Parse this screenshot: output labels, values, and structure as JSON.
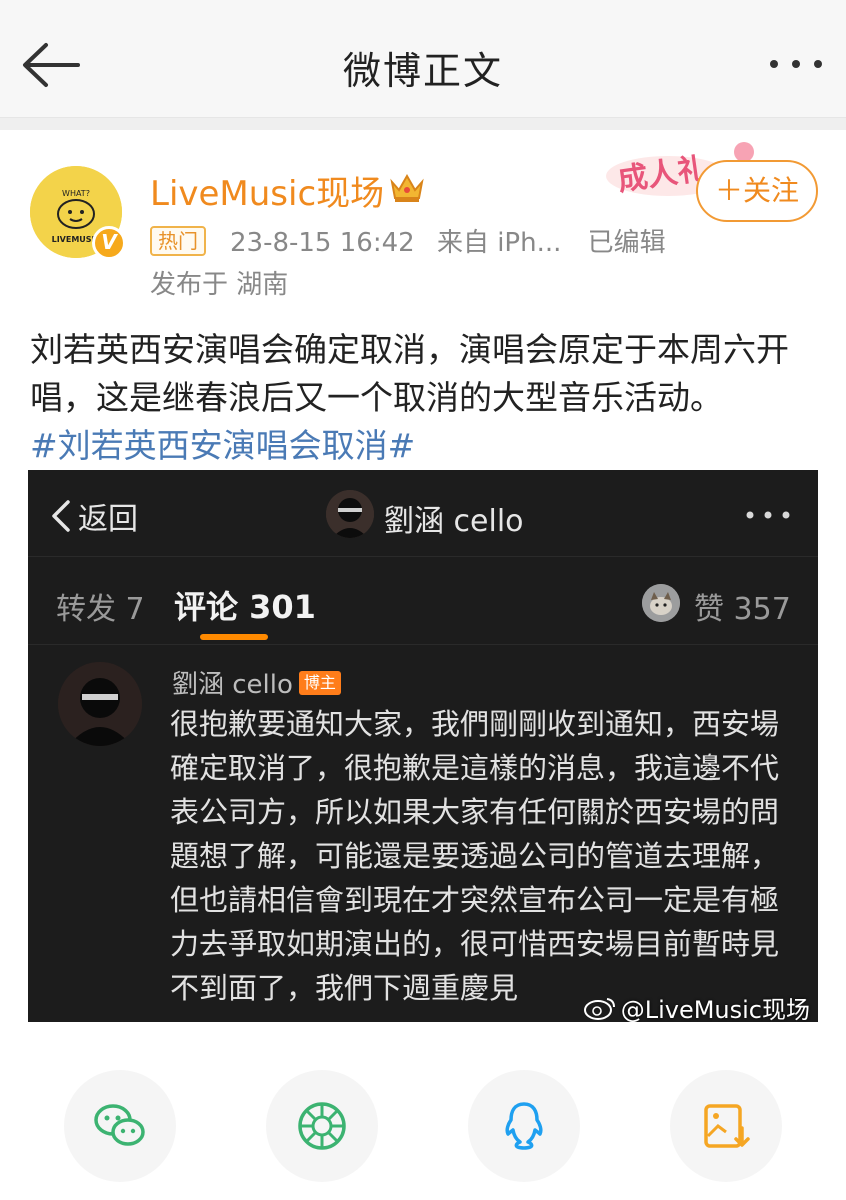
{
  "nav": {
    "title": "微博正文",
    "back_icon": "arrow-left-icon",
    "more_icon": "more-horizontal-icon"
  },
  "post": {
    "author": "LiveMusic现场",
    "avatar_text": "LIVEMUSIC",
    "avatar_badge": "V",
    "hot_tag": "热门",
    "time": "23-8-15 16:42",
    "source": "来自 iPh...",
    "edited": "已编辑",
    "location": "发布于 湖南",
    "promo": "成人礼",
    "follow_label": "＋关注",
    "text": "刘若英西安演唱会确定取消，演唱会原定于本周六开唱，这是继春浪后又一个取消的大型音乐活动。",
    "hashtag": "#刘若英西安演唱会取消#"
  },
  "embed": {
    "back_label": "返回",
    "title": "劉涵 cello",
    "tab_repost": "转发 7",
    "tab_comment": "评论 301",
    "tab_like": "赞 357",
    "comment": {
      "name": "劉涵 cello",
      "badge": "博主",
      "text": "很抱歉要通知大家，我們剛剛收到通知，西安場確定取消了，很抱歉是這樣的消息，我這邊不代表公司方，所以如果大家有任何關於西安場的問題想了解，可能還是要透過公司的管道去理解，但也請相信會到現在才突然宣布公司一定是有極力去爭取如期演出的，很可惜西安場目前暫時見不到面了，我們下週重慶見"
    },
    "watermark": "@LiveMusic现场"
  },
  "share": {
    "items": [
      {
        "icon": "wechat-icon",
        "color": "#3cb371"
      },
      {
        "icon": "moments-icon",
        "color": "#3cb371"
      },
      {
        "icon": "qq-icon",
        "color": "#1fa0f0"
      },
      {
        "icon": "save-image-icon",
        "color": "#f5a623"
      }
    ]
  },
  "colors": {
    "brand_orange": "#f08a1e",
    "hashtag_blue": "#4a7ab5"
  }
}
